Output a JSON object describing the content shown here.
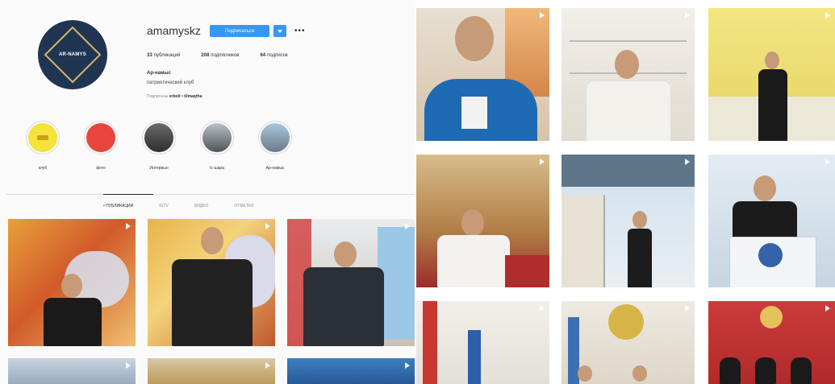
{
  "profile": {
    "username": "amamyskz",
    "follow_label": "Подписаться",
    "more_label": "•••",
    "stats": [
      {
        "count": "33",
        "label": "публикаций"
      },
      {
        "count": "208",
        "label": "подписчиков"
      },
      {
        "count": "64",
        "label": "подписок"
      }
    ],
    "bio_name": "Ар-намыс",
    "bio_text": "патриотический клуб",
    "followed_by_prefix": "Подписаны",
    "followed_by": "erbolt • tilmaqtha"
  },
  "highlights": [
    {
      "label": "клуб",
      "color": "#f5e23a"
    },
    {
      "label": "фото",
      "color": "#e8453c"
    },
    {
      "label": "Интервью",
      "color": "#4a4a4a"
    },
    {
      "label": "Іс-шара",
      "color": "#7d8a8c"
    },
    {
      "label": "Ар-намыс",
      "color": "#8fa9be"
    }
  ],
  "tabs": [
    {
      "label": "• ПУБЛИКАЦИИ",
      "active": true
    },
    {
      "label": "IGTV",
      "active": false
    },
    {
      "label": "ВИДЕО",
      "active": false
    },
    {
      "label": "ОТМЕТКИ",
      "active": false
    }
  ],
  "colors": {
    "accent": "#3897f0"
  }
}
